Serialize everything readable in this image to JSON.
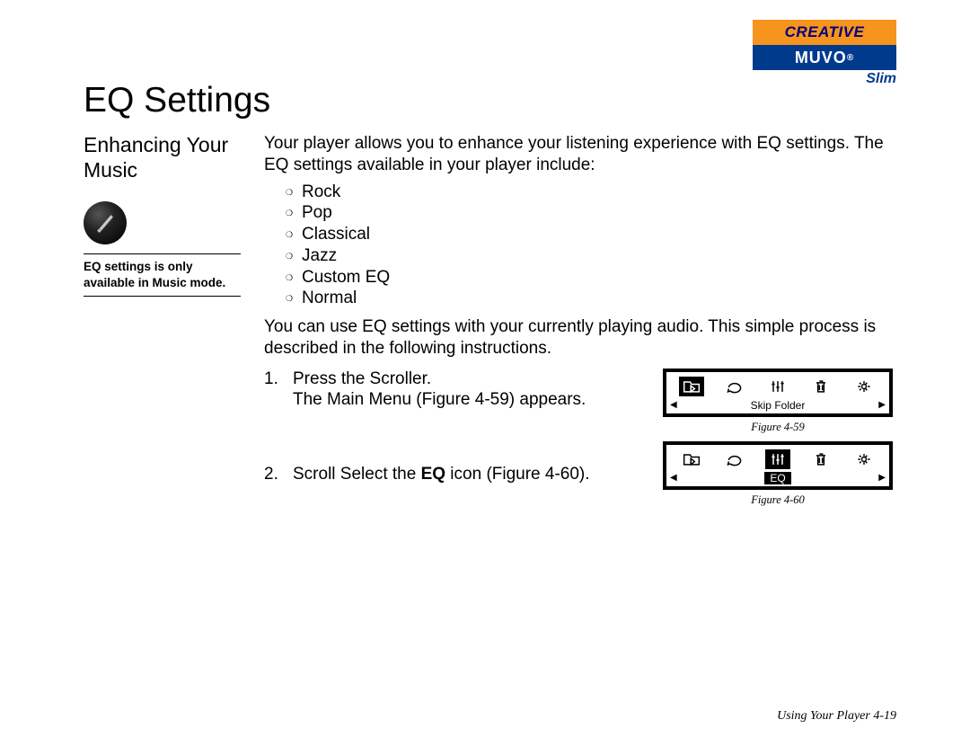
{
  "logo": {
    "top": "CREATIVE",
    "bot": "MUVO",
    "reg": "®",
    "slim": "Slim"
  },
  "title": "EQ Settings",
  "subtitle": "Enhancing Your Music",
  "tip_text": "EQ settings is only available in Music mode.",
  "intro": "Your player allows you to enhance your listening experience with EQ settings. The EQ settings available in your player include:",
  "presets": [
    "Rock",
    "Pop",
    "Classical",
    "Jazz",
    "Custom EQ",
    "Normal"
  ],
  "description": "You can use EQ settings with your currently playing audio. This simple process is described in the following instructions.",
  "steps": [
    {
      "num": "1.",
      "text_a": "Press the Scroller.",
      "text_b": "The Main Menu (Figure 4-59) appears."
    },
    {
      "num": "2.",
      "text_a": "Scroll Select the ",
      "bold": "EQ",
      "text_b": " icon (Figure 4-60)."
    }
  ],
  "figures": [
    {
      "caption": "Figure 4-59",
      "label": "Skip Folder",
      "selected_index": 0
    },
    {
      "caption": "Figure 4-60",
      "label": "EQ",
      "selected_index": 2
    }
  ],
  "footer": "Using Your Player 4-19"
}
